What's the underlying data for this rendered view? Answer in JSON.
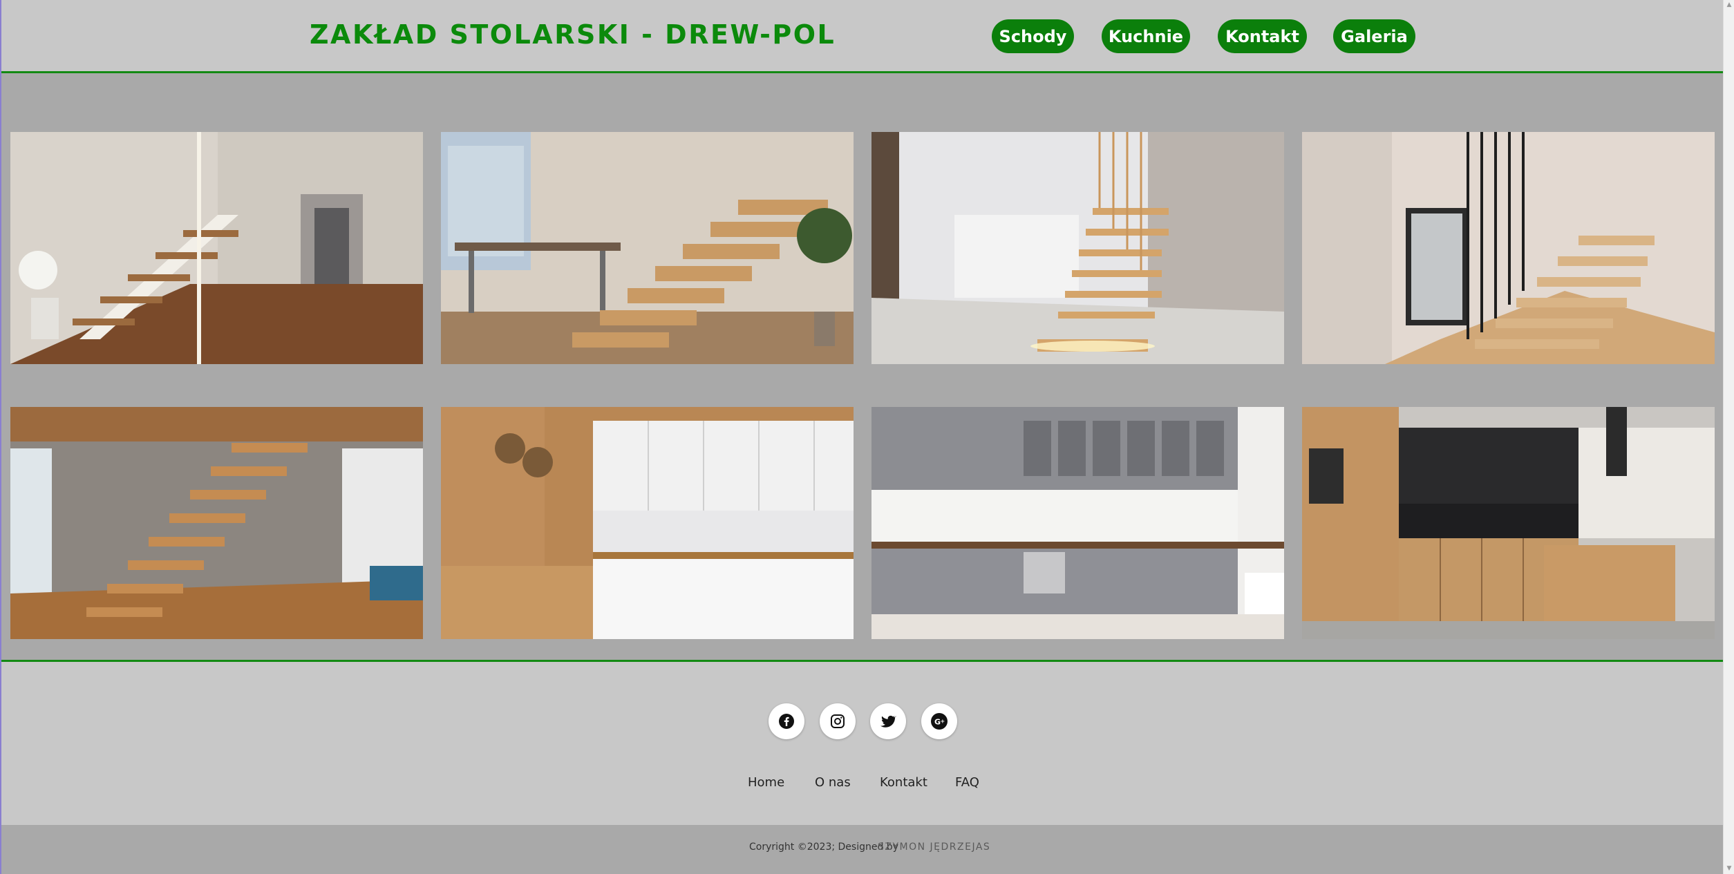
{
  "header": {
    "title": "ZAKŁAD STOLARSKI - DREW-POL",
    "nav": [
      {
        "label": "Schody"
      },
      {
        "label": "Kuchnie"
      },
      {
        "label": "Kontakt"
      },
      {
        "label": "Galeria"
      }
    ]
  },
  "colors": {
    "brand_green": "#0b7f0b",
    "header_bg": "#c8c8c8",
    "gallery_bg": "#a9a9a9"
  },
  "gallery": {
    "images": [
      {
        "icon": "stairs-photo-1"
      },
      {
        "icon": "stairs-photo-2"
      },
      {
        "icon": "stairs-photo-3"
      },
      {
        "icon": "stairs-photo-4"
      },
      {
        "icon": "stairs-photo-5"
      },
      {
        "icon": "kitchen-photo-1"
      },
      {
        "icon": "kitchen-photo-2"
      },
      {
        "icon": "kitchen-photo-3"
      }
    ]
  },
  "footer": {
    "social": [
      {
        "icon": "facebook-icon"
      },
      {
        "icon": "instagram-icon"
      },
      {
        "icon": "twitter-icon"
      },
      {
        "icon": "google-plus-icon"
      }
    ],
    "links": [
      {
        "label": "Home"
      },
      {
        "label": "O nas"
      },
      {
        "label": "Kontakt"
      },
      {
        "label": "FAQ"
      }
    ],
    "copyright": "Coryright ©2023; Designed by",
    "designer": "SZYMON JĘDRZEJAS"
  }
}
